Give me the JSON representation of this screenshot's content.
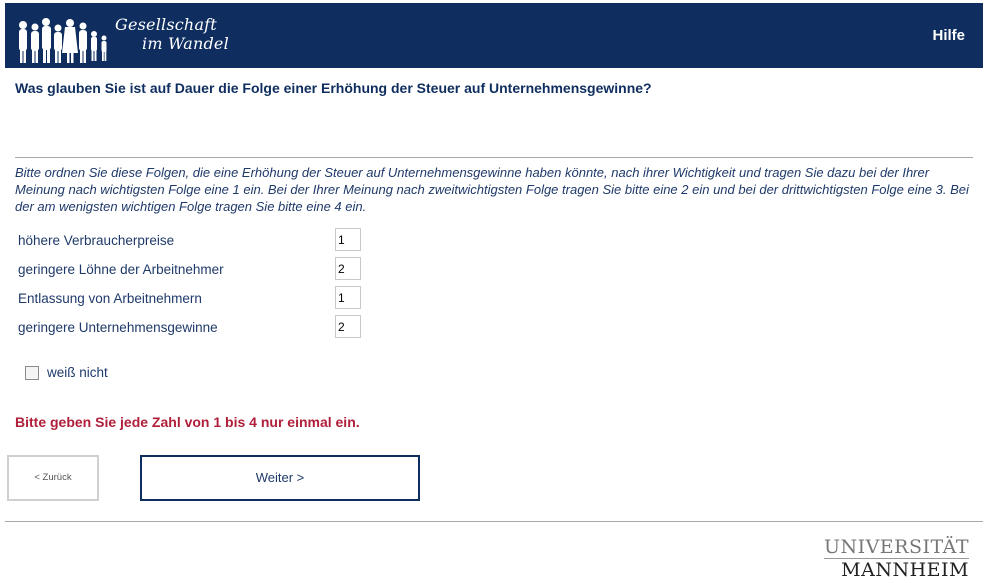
{
  "header": {
    "logo_line1": "Gesellschaft",
    "logo_line2": "im Wandel",
    "help_label": "Hilfe",
    "background_color": "#0f2e5f"
  },
  "question": "Was glauben Sie ist auf Dauer die Folge einer Erhöhung der Steuer auf Unternehmensgewinne?",
  "instruction": "Bitte ordnen Sie diese Folgen, die eine Erhöhung der Steuer auf Unternehmensgewinne haben könnte, nach ihrer Wichtigkeit und tragen Sie dazu bei der Ihrer Meinung nach wichtigsten Folge eine 1 ein. Bei der Ihrer Meinung nach zweitwichtigsten Folge tragen Sie bitte eine 2 ein und bei der drittwichtigsten Folge eine 3. Bei der am wenigsten wichtigen Folge tragen Sie bitte eine 4 ein.",
  "items": [
    {
      "label": "höhere Verbraucherpreise",
      "value": "1"
    },
    {
      "label": "geringere Löhne der Arbeitnehmer",
      "value": "2"
    },
    {
      "label": "Entlassung von Arbeitnehmern",
      "value": "1"
    },
    {
      "label": "geringere Unternehmensgewinne",
      "value": "2"
    }
  ],
  "dont_know_label": "weiß nicht",
  "dont_know_checked": false,
  "error_message": "Bitte geben Sie jede Zahl von 1 bis 4 nur einmal ein.",
  "error_color": "#b01f3a",
  "buttons": {
    "back": "< Zurück",
    "next": "Weiter >"
  },
  "footer": {
    "uni_line1": "UNIVERSITÄT",
    "uni_line2": "MANNHEIM"
  }
}
